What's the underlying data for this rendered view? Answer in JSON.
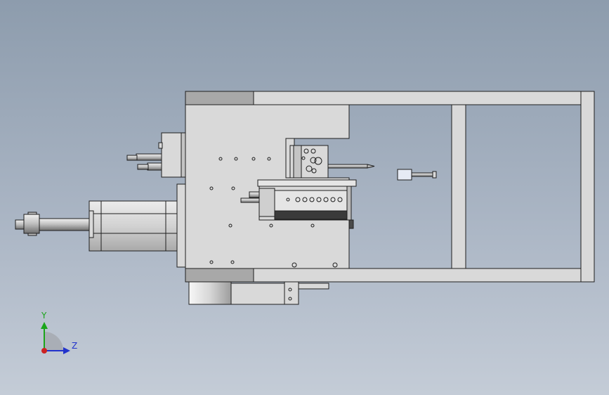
{
  "viewport": {
    "background_top": "#8d9cad",
    "background_bottom": "#c4ccd7"
  },
  "model": {
    "part_fill": "#d9d9d9",
    "part_fill_dark": "#a8a8a8",
    "edge_color": "#1e1e1e"
  },
  "triad": {
    "y_label": "Y",
    "z_label": "Z",
    "y_color": "#1aa51a",
    "z_color": "#2233cc",
    "x_color": "#cc2222",
    "icon": "coordinate-triad-icon"
  }
}
